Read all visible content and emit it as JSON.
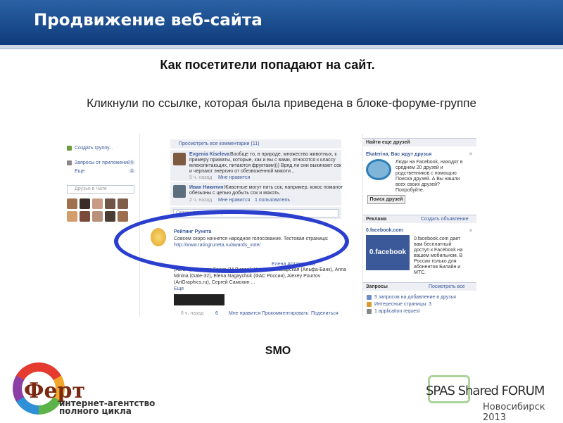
{
  "header": {
    "title": "Продвижение веб-сайта"
  },
  "heading": "Как посетители попадают на сайт.",
  "subheading": "Кликнули по ссылке, которая была приведена в блоке-форуме-группе",
  "caption": "SMO",
  "colors": {
    "header_blue": "#1a4c8f",
    "facebook_blue": "#3b5998",
    "highlight_ellipse": "#2b3fcf",
    "panel_gray": "#edeff4"
  },
  "screenshot": {
    "left": {
      "create_group": "Создать группу...",
      "app_requests": "Запросы от приложений",
      "app_requests_count": "1",
      "more": "Еще",
      "more_count": "1",
      "friends_search_placeholder": "Друзья в Чате"
    },
    "middle": {
      "view_all_comments": "Просмотреть все комментарии (11)",
      "comment1": {
        "author": "Evgenia Kiseleva",
        "text1": "Вообще то, в природе, множество животных, к",
        "text2": "примеру приматы, которые, как и вы с вами, относятся к классу",
        "text3": "млекопитающих, питаются фруктами))) Вряд ли они выкинают сок",
        "text4": "и черпают энергию от обезвоженной мякоти...",
        "time": "5 ч. назад",
        "like": "Мне нравится"
      },
      "comment2": {
        "author": "Иван Никитин",
        "text1": "Животные могут пить сок, например, кокос поманот",
        "text2": "обезьяны с целью добыть сок и мякоть.",
        "time": "2 ч. назад",
        "like": "Мне нравится",
        "likes": "1 пользователь"
      },
      "write_comment": "Оставить комментарий...",
      "post": {
        "author": "Рейтинг Рунета",
        "text": "Совсем скоро начнется народное голосование. Тестовая страница:",
        "link": "http://www.ratingruneta.ru/awards_vote/",
        "names1": "Елена Артамонова",
        "names2": "(ADCR), Максим Захир (М.Видео), Наталья Масарская (Альфа-Банк), Anna",
        "names3": "Minina (Gate-32), Elena Nagaychuk (ФАС России), Alexey Pourtov",
        "names4": "(ArtGraphics.ru), Сергей Самохин ...",
        "more": "Еще",
        "time": "6 ч. назад",
        "count": "6",
        "like": "Мне нравится",
        "comment": "Прокомментировать",
        "share": "Поделиться"
      }
    },
    "right": {
      "find_friends_title": "Найти еще друзей",
      "find_friends_name": "Ekaterina, Вас ждут друзья",
      "find_friends_text1": "Люди на Facebook, находят в",
      "find_friends_text2": "среднем 20 друзей и",
      "find_friends_text3": "родственников с помощью",
      "find_friends_text4": "Поиска друзей. А Вы нашли",
      "find_friends_text5": "всех своих друзей?",
      "find_friends_text6": "Попробуйте.",
      "find_friends_button": "Поиск друзей",
      "ads_title": "Реклама",
      "create_ad": "Создать объявление",
      "ad_url": "0.facebook.com",
      "ad_image_text": "0.facebook",
      "ad_text1": "0.facebook.com дает",
      "ad_text2": "вам бесплатный",
      "ad_text3": "доступ к Facebook на",
      "ad_text4": "вашем мобильном. В",
      "ad_text5": "России только для",
      "ad_text6": "абонентов Билайн и",
      "ad_text7": "МТС.",
      "requests_title": "Запросы",
      "view_all": "Посмотреть все",
      "req1": "5 запросов на добавление в друзья",
      "req2": "Интересные страницы: 3",
      "req3": "1 application request"
    }
  },
  "logo_left": {
    "name": "Ферт",
    "tagline1": "интернет-агентство",
    "tagline2": "полного цикла"
  },
  "logo_right": {
    "name": "SPAS Shared FORUM",
    "city": "Новосибирск 2013"
  }
}
